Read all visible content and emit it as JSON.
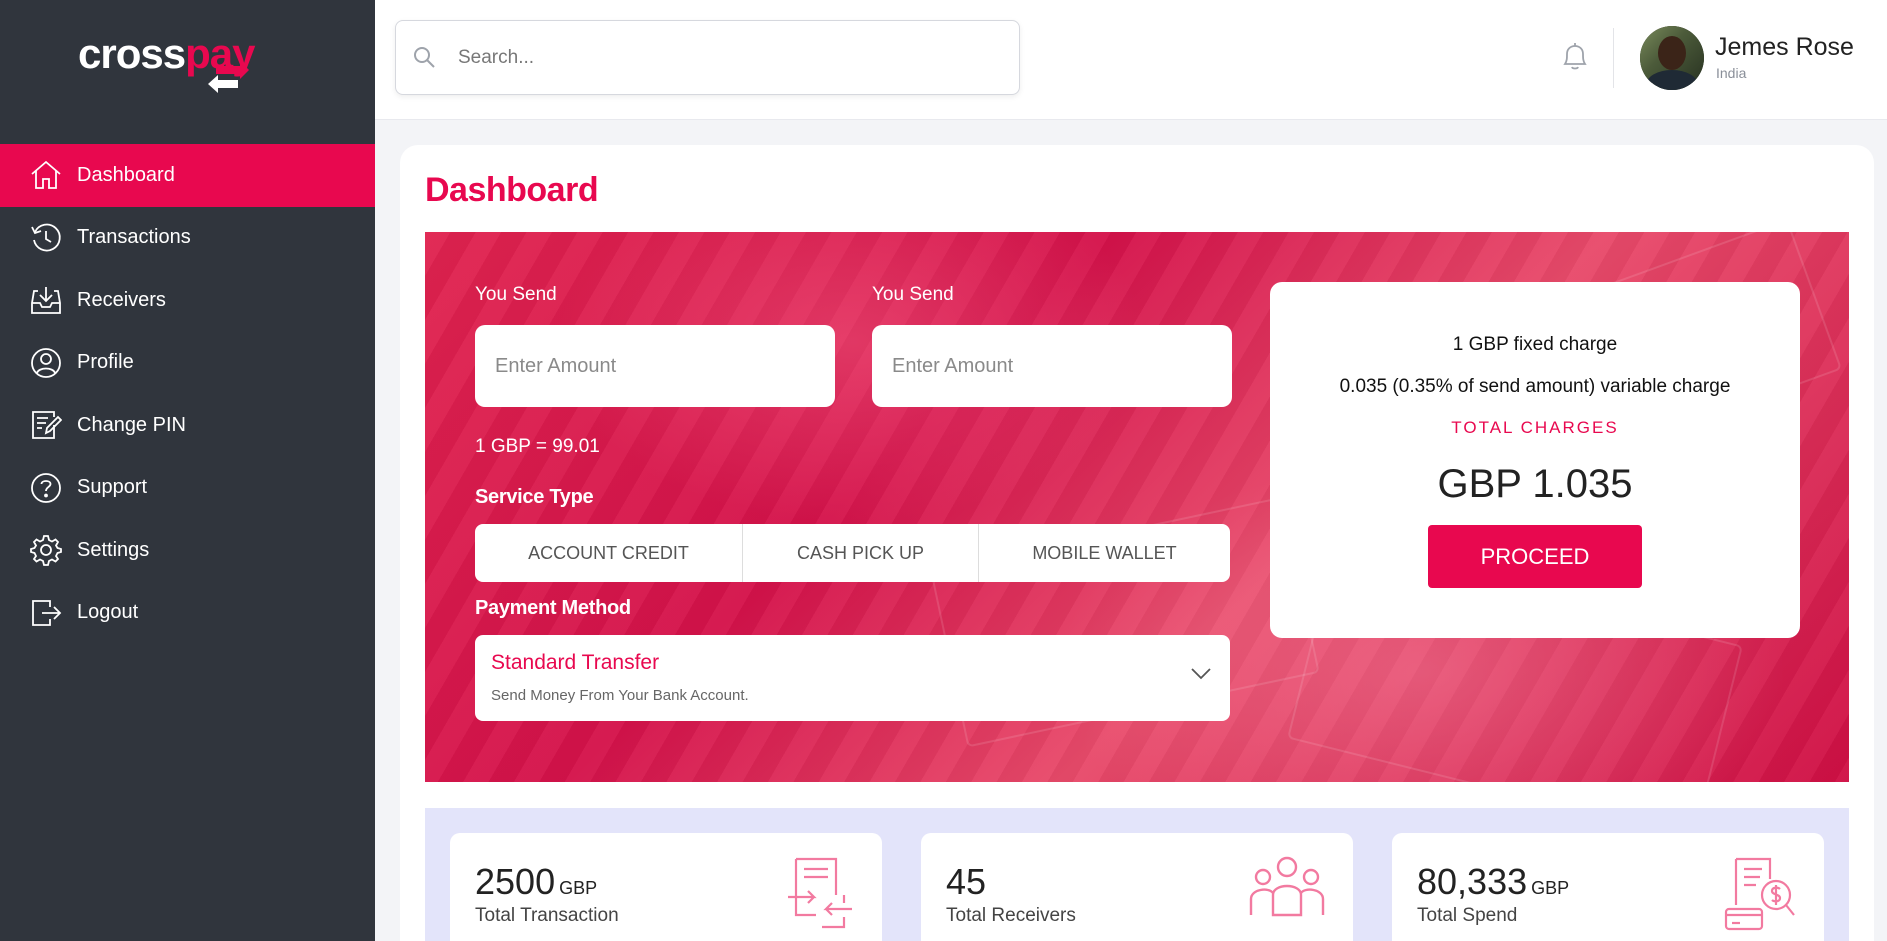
{
  "app": {
    "logo_part1": "cross",
    "logo_part2": "pay"
  },
  "sidebar": {
    "items": [
      {
        "label": "Dashboard",
        "icon": "home-icon",
        "active": true
      },
      {
        "label": "Transactions",
        "icon": "history-icon",
        "active": false
      },
      {
        "label": "Receivers",
        "icon": "inbox-download-icon",
        "active": false
      },
      {
        "label": "Profile",
        "icon": "user-circle-icon",
        "active": false
      },
      {
        "label": "Change PIN",
        "icon": "edit-note-icon",
        "active": false
      },
      {
        "label": "Support",
        "icon": "question-circle-icon",
        "active": false
      },
      {
        "label": "Settings",
        "icon": "gear-icon",
        "active": false
      },
      {
        "label": "Logout",
        "icon": "logout-icon",
        "active": false
      }
    ]
  },
  "header": {
    "search_placeholder": "Search...",
    "user_name": "Jemes Rose",
    "user_location": "India"
  },
  "main": {
    "title": "Dashboard",
    "send": {
      "label_1": "You Send",
      "label_2": "You Send",
      "placeholder_1": "Enter Amount",
      "placeholder_2": "Enter Amount",
      "rate": "1 GBP = 99.01"
    },
    "service_type": {
      "title": "Service Type",
      "options": [
        "ACCOUNT CREDIT",
        "CASH PICK UP",
        "MOBILE WALLET"
      ]
    },
    "payment_method": {
      "title": "Payment Method",
      "selected_title": "Standard Transfer",
      "selected_sub": "Send Money From Your Bank Account."
    },
    "charges": {
      "fixed": "1 GBP fixed charge",
      "variable": "0.035 (0.35% of send amount) variable charge",
      "total_label": "TOTAL CHARGES",
      "total_value": "GBP 1.035",
      "proceed_label": "PROCEED"
    },
    "stats": [
      {
        "value": "2500",
        "unit": "GBP",
        "label": "Total Transaction",
        "icon": "transfer-document-icon"
      },
      {
        "value": "45",
        "unit": "",
        "label": "Total Receivers",
        "icon": "users-group-icon"
      },
      {
        "value": "80,333",
        "unit": "GBP",
        "label": "Total Spend",
        "icon": "invoice-dollar-icon"
      }
    ]
  },
  "colors": {
    "brand": "#e8084f",
    "sidebar_bg": "#30353d",
    "stats_bg": "#e3e4fa"
  }
}
